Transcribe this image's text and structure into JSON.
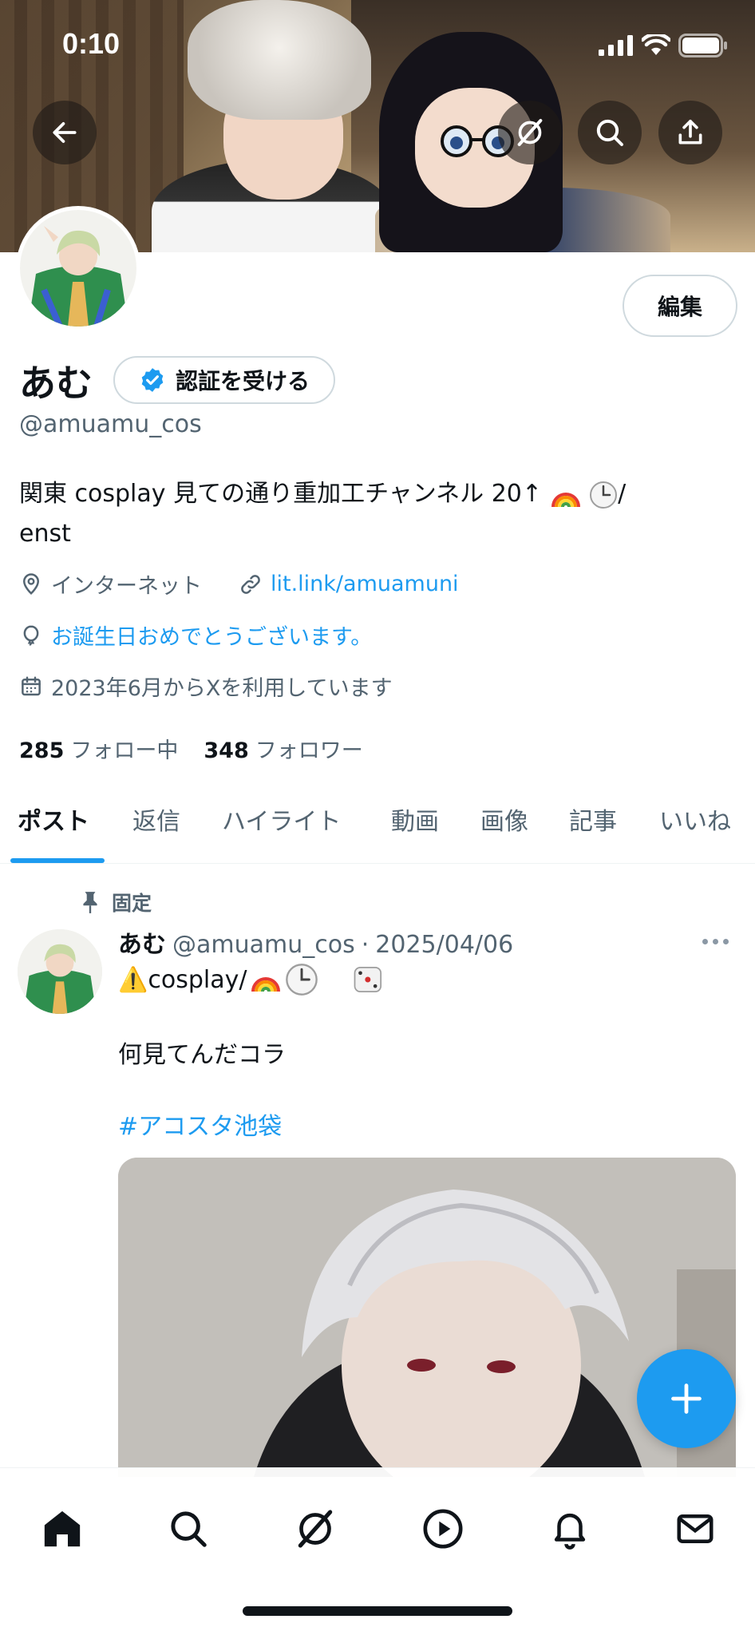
{
  "status_bar": {
    "time": "0:10"
  },
  "header": {
    "back_icon": "arrow-left-icon",
    "grok_icon": "grok-icon",
    "search_icon": "search-icon",
    "share_icon": "share-icon"
  },
  "profile": {
    "display_name": "あむ",
    "verify_label": "認証を受ける",
    "handle": "@amuamu_cos",
    "edit_label": "編集",
    "bio_line1": "関東 cosplay 見ての通り重加工チャンネル 20↑",
    "bio_line1_tail": "/",
    "bio_line2": "enst",
    "location": "インターネット",
    "website": "lit.link/amuamuni",
    "birthday": "お誕生日おめでとうございます。",
    "joined": "2023年6月からXを利用しています",
    "following_count": "285",
    "following_label": "フォロー中",
    "followers_count": "348",
    "followers_label": "フォロワー"
  },
  "tabs": [
    {
      "label": "ポスト",
      "active": true
    },
    {
      "label": "返信"
    },
    {
      "label": "ハイライト"
    },
    {
      "label": "動画"
    },
    {
      "label": "画像"
    },
    {
      "label": "記事"
    },
    {
      "label": "いいね"
    }
  ],
  "post": {
    "pinned_label": "固定",
    "author_name": "あむ",
    "author_handle": "@amuamu_cos",
    "separator": "·",
    "date": "2025/04/06",
    "line1_prefix": "⚠️cosplay/",
    "text": "何見てんだコラ",
    "hashtag": "#アコスタ池袋"
  },
  "bottom_nav": [
    "home-icon",
    "search-icon",
    "grok-icon",
    "video-icon",
    "notifications-icon",
    "messages-icon"
  ],
  "colors": {
    "accent": "#1d9bf0",
    "text": "#0f1419",
    "secondary": "#536471",
    "border": "#cfd9de"
  }
}
